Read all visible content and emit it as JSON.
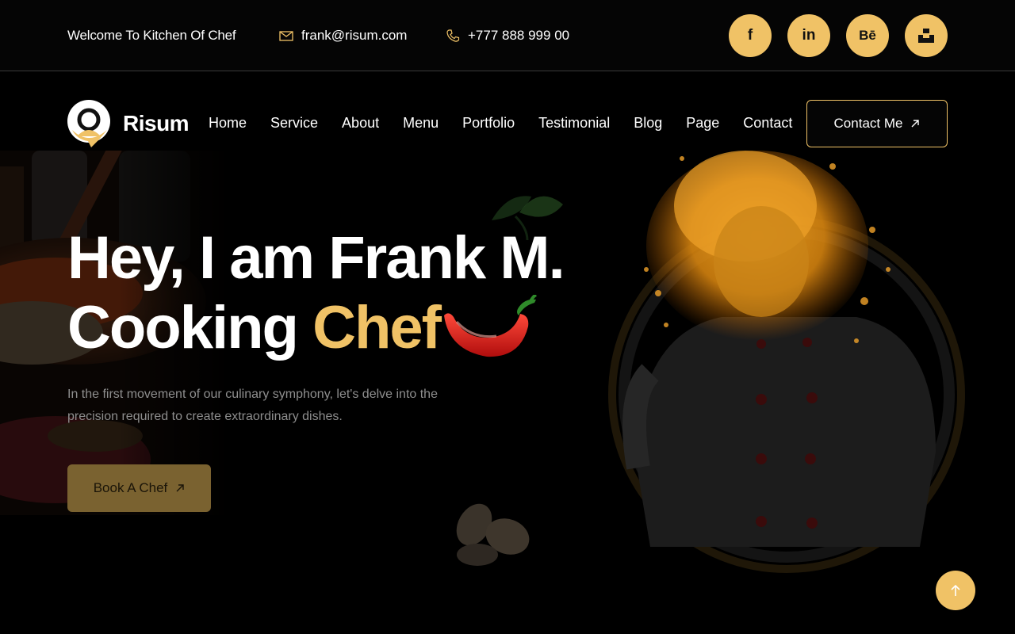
{
  "topbar": {
    "welcome": "Welcome To Kitchen Of Chef",
    "email": "frank@risum.com",
    "phone": "+777 888 999 00",
    "socials": [
      {
        "icon": "facebook-icon",
        "glyph": "f"
      },
      {
        "icon": "linkedin-icon",
        "glyph": "in"
      },
      {
        "icon": "behance-icon",
        "glyph": "Bē"
      },
      {
        "icon": "unsplash-icon",
        "glyph": ""
      }
    ]
  },
  "brand": {
    "name": "Risum"
  },
  "nav": {
    "items": [
      "Home",
      "Service",
      "About",
      "Menu",
      "Portfolio",
      "Testimonial",
      "Blog",
      "Page",
      "Contact"
    ],
    "cta": "Contact Me"
  },
  "hero": {
    "line1": "Hey, I am Frank M.",
    "line2_prefix": "Cooking ",
    "line2_accent": "Chef",
    "description": "In the first movement of our culinary symphony, let's delve into the precision required to create extraordinary dishes.",
    "button": "Book A Chef"
  },
  "colors": {
    "accent": "#f0c266",
    "background": "#000000"
  }
}
